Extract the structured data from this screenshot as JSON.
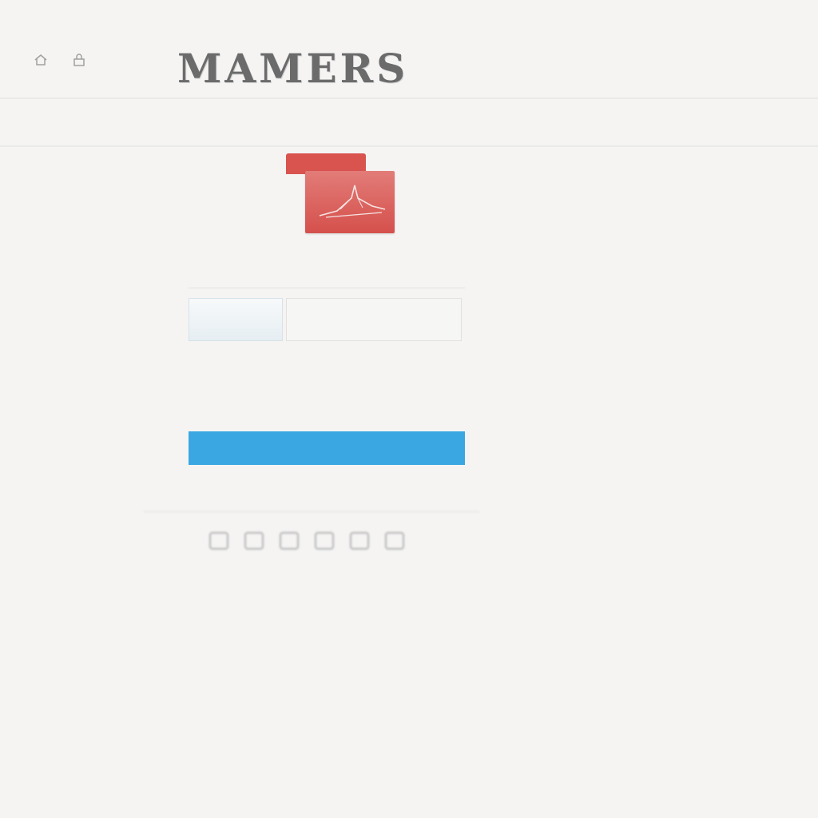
{
  "header": {
    "brand": "MAMERS",
    "tagline": "",
    "subtag": ""
  },
  "logo": {
    "tab_label": ""
  },
  "form": {
    "row1": {
      "label": "",
      "value": "",
      "value2": "",
      "hint": ""
    },
    "inputs": {
      "first_value": "",
      "second_placeholder": ""
    },
    "row2": {
      "a": "",
      "b": "",
      "c": ""
    },
    "submit_label": ""
  },
  "footer": {
    "line1": "",
    "line2": "",
    "line3": "",
    "line4": ""
  },
  "icons": {
    "corner": [
      "home-icon",
      "lock-icon"
    ],
    "logo": "ship-icon",
    "footer": [
      "square-icon",
      "square-icon",
      "message-icon",
      "square-icon",
      "square-icon",
      "square-icon"
    ]
  },
  "colors": {
    "accent": "#3aa7e3",
    "brand_red": "#d9534f"
  }
}
